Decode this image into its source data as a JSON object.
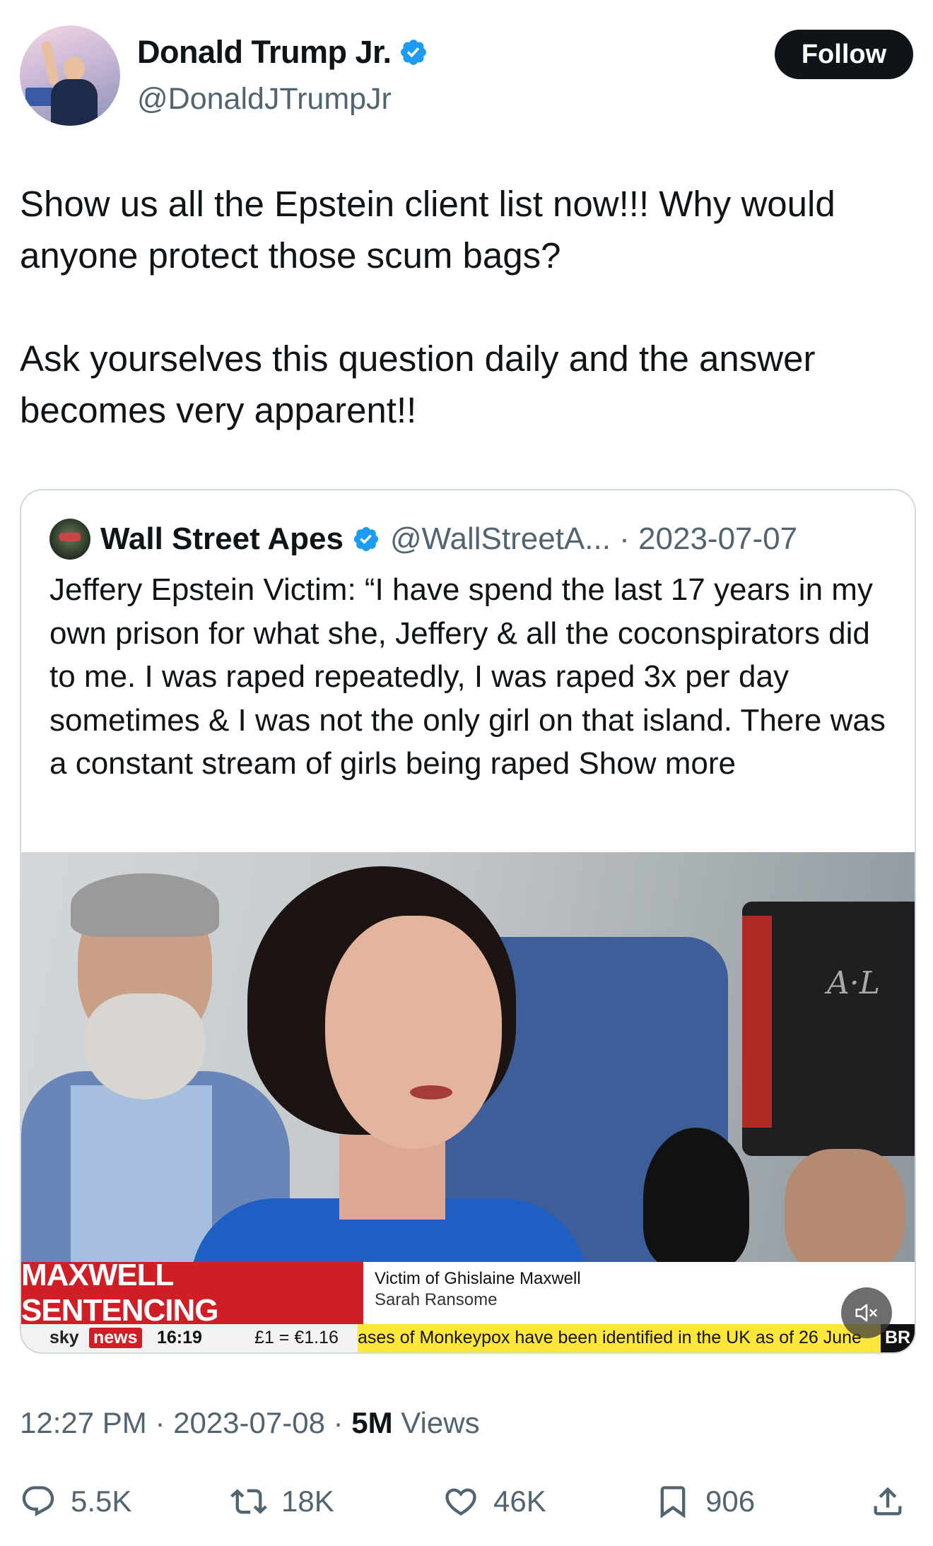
{
  "author": {
    "name": "Donald Trump Jr.",
    "handle": "@DonaldJTrumpJr",
    "verified": true,
    "follow_label": "Follow"
  },
  "tweet": {
    "paragraphs": [
      "Show us all the Epstein client list now!!! Why would anyone protect those scum bags?",
      "Ask yourselves this question daily and the answer becomes very apparent!!"
    ]
  },
  "quoted": {
    "name": "Wall Street Apes",
    "handle_date": "@WallStreetA... · 2023-07-07",
    "text": "Jeffery Epstein Victim: “I have spend the last 17 years in my own prison for what she, Jeffery & all the coconspirators did to me. I was raped repeatedly, I was raped 3x per day sometimes & I was not the only girl on that island. There was a constant stream of girls being raped",
    "show_more": "Show more",
    "video": {
      "headline": "MAXWELL SENTENCING",
      "caption_title": "Victim of Ghislaine Maxwell",
      "caption_name": "Sarah Ransome",
      "ticker_brand_1": "sky",
      "ticker_brand_2": "news",
      "ticker_time": "16:19",
      "ticker_fx": "£1 = €1.16",
      "ticker_scroll": "ases of Monkeypox have been identified in the UK as of 26 June",
      "ticker_tag": "BR",
      "camera_logo": "A·L"
    }
  },
  "meta": {
    "time_date": "12:27 PM · 2023-07-08 · ",
    "views_count": "5M",
    "views_label": " Views"
  },
  "actions": {
    "replies": "5.5K",
    "reposts": "18K",
    "likes": "46K",
    "bookmarks": "906"
  },
  "colors": {
    "verified_blue": "#1d9bf0",
    "text_primary": "#0f1419",
    "text_secondary": "#536471",
    "border": "#cfd9de",
    "sky_red": "#d01e26"
  }
}
